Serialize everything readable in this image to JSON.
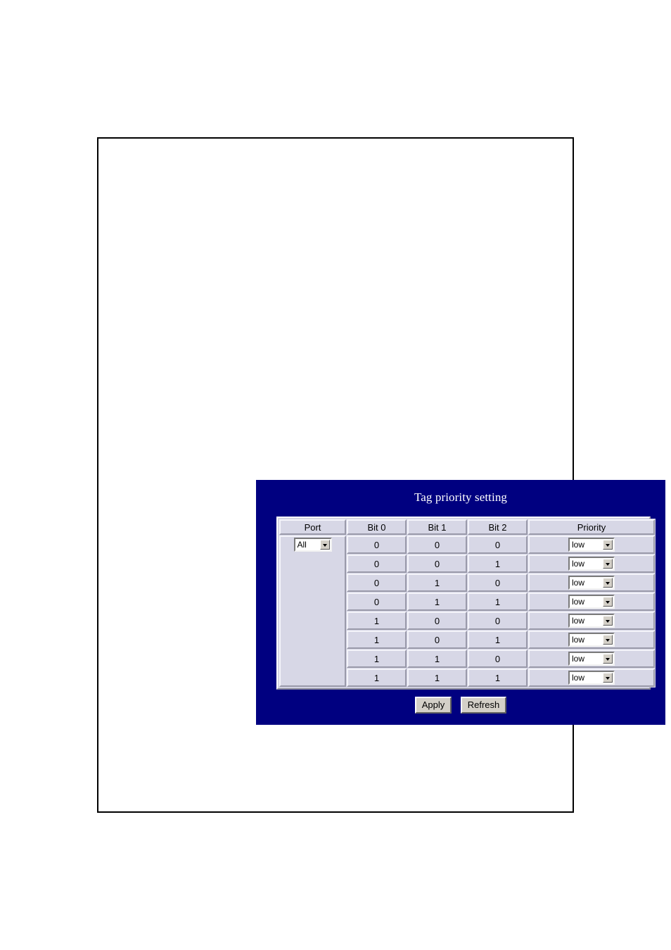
{
  "panel": {
    "title": "Tag priority setting",
    "background_color": "#000080",
    "title_color": "#ffffff"
  },
  "table": {
    "headers": [
      "Port",
      "Bit 0",
      "Bit 1",
      "Bit 2",
      "Priority"
    ],
    "port": {
      "selected": "All",
      "options": [
        "All"
      ]
    },
    "rows": [
      {
        "bit0": "0",
        "bit1": "0",
        "bit2": "0",
        "priority": "low"
      },
      {
        "bit0": "0",
        "bit1": "0",
        "bit2": "1",
        "priority": "low"
      },
      {
        "bit0": "0",
        "bit1": "1",
        "bit2": "0",
        "priority": "low"
      },
      {
        "bit0": "0",
        "bit1": "1",
        "bit2": "1",
        "priority": "low"
      },
      {
        "bit0": "1",
        "bit1": "0",
        "bit2": "0",
        "priority": "low"
      },
      {
        "bit0": "1",
        "bit1": "0",
        "bit2": "1",
        "priority": "low"
      },
      {
        "bit0": "1",
        "bit1": "1",
        "bit2": "0",
        "priority": "low"
      },
      {
        "bit0": "1",
        "bit1": "1",
        "bit2": "1",
        "priority": "low"
      }
    ]
  },
  "buttons": {
    "apply": "Apply",
    "refresh": "Refresh"
  }
}
